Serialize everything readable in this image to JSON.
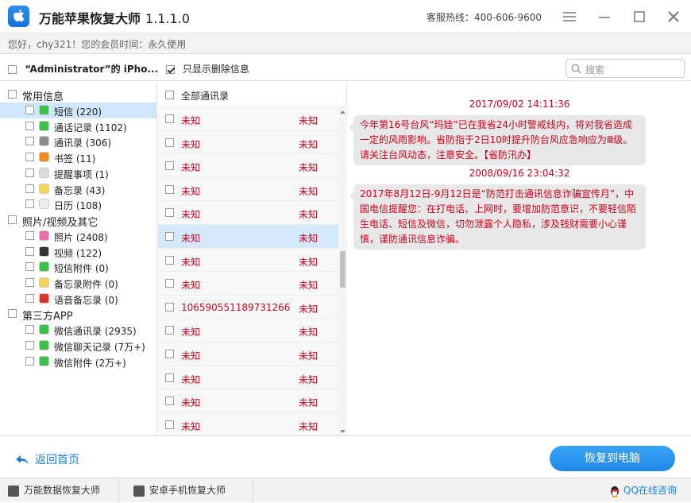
{
  "app": {
    "title": "万能苹果恢复大师",
    "version": "1.1.1.0",
    "hotline": "客服热线：400-606-9600"
  },
  "user_bar": "您好，chy321！您的会员时间：永久使用",
  "toolbar": {
    "device": "“Administrator”的 iPho...",
    "only_deleted": "只显示删除信息",
    "search_placeholder": "搜索"
  },
  "sidebar": {
    "groups": [
      {
        "label": "常用信息",
        "items": [
          {
            "label": "短信 (220)",
            "icon": "message-icon",
            "color": "#3cc04a"
          },
          {
            "label": "通话记录 (1102)",
            "icon": "phone-icon",
            "color": "#3cc04a"
          },
          {
            "label": "通讯录 (306)",
            "icon": "contacts-icon",
            "color": "#8e8e8e"
          },
          {
            "label": "书签 (11)",
            "icon": "bookmark-icon",
            "color": "#f08a24"
          },
          {
            "label": "提醒事项 (1)",
            "icon": "reminder-icon",
            "color": "#dcdcdc"
          },
          {
            "label": "备忘录 (43)",
            "icon": "notes-icon",
            "color": "#f4d35e"
          },
          {
            "label": "日历 (108)",
            "icon": "calendar-icon",
            "color": "#eeeeee"
          }
        ]
      },
      {
        "label": "照片/视频及其它",
        "items": [
          {
            "label": "照片 (2408)",
            "icon": "photos-icon",
            "color": "#e86fa7"
          },
          {
            "label": "视频 (122)",
            "icon": "video-icon",
            "color": "#333333"
          },
          {
            "label": "短信附件 (0)",
            "icon": "attachment-icon",
            "color": "#3cc04a"
          },
          {
            "label": "备忘录附件 (0)",
            "icon": "notes-attachment-icon",
            "color": "#f4d35e"
          },
          {
            "label": "语音备忘录 (0)",
            "icon": "voice-memo-icon",
            "color": "#d9342b"
          }
        ]
      },
      {
        "label": "第三方APP",
        "items": [
          {
            "label": "微信通讯录 (2935)",
            "icon": "wechat-icon",
            "color": "#3cc04a"
          },
          {
            "label": "微信聊天记录 (7万+)",
            "icon": "wechat-icon",
            "color": "#3cc04a"
          },
          {
            "label": "微信附件 (2万+)",
            "icon": "wechat-icon",
            "color": "#3cc04a"
          }
        ]
      }
    ]
  },
  "list": {
    "header": "全部通讯录",
    "rows": [
      {
        "name": "未知",
        "number": "未知"
      },
      {
        "name": "未知",
        "number": "未知"
      },
      {
        "name": "未知",
        "number": "未知"
      },
      {
        "name": "未知",
        "number": "未知"
      },
      {
        "name": "未知",
        "number": "未知"
      },
      {
        "name": "未知",
        "number": "未知"
      },
      {
        "name": "未知",
        "number": "未知"
      },
      {
        "name": "未知",
        "number": "未知"
      },
      {
        "name": "106590551189731266",
        "number": "未知"
      },
      {
        "name": "未知",
        "number": "未知"
      },
      {
        "name": "未知",
        "number": "未知"
      },
      {
        "name": "未知",
        "number": "未知"
      },
      {
        "name": "未知",
        "number": "未知"
      },
      {
        "name": "未知",
        "number": "未知"
      }
    ]
  },
  "messages": [
    {
      "time": "2017/09/02 14:11:36",
      "text": "今年第16号台风“玛娃”已在我省24小时警戒线内，将对我省造成一定的风雨影响。省防指于2日10时提升防台风应急响应为Ⅲ级。请关注台风动态，注意安全。【省防汛办】"
    },
    {
      "time": "2008/09/16 23:04:32",
      "text": "2017年8月12日-9月12日是“防范打击通讯信息诈骗宣传月”，中国电信提醒您：在打电话、上网时，要增加防范意识，不要轻信陌生电话、短信及微信，切勿泄露个人隐私，涉及钱财需要小心谨慎，谨防通讯信息诈骗。"
    }
  ],
  "footer": {
    "back": "返回首页",
    "recover": "恢复到电脑",
    "tabs": [
      "万能数据恢复大师",
      "安卓手机恢复大师"
    ],
    "qq": "QQ在线咨询"
  },
  "colors": {
    "accent": "#1f88e8",
    "deleted_text": "#d0021b"
  }
}
